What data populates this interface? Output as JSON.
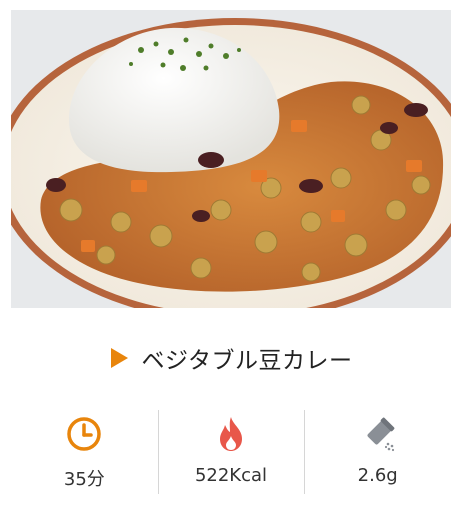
{
  "recipe": {
    "image_alt": "",
    "title": "ベジタブル豆カレー",
    "accent_color": "#e8850c",
    "stats": [
      {
        "icon": "clock-icon",
        "value": "35分"
      },
      {
        "icon": "flame-icon",
        "value": "522Kcal"
      },
      {
        "icon": "salt-shaker-icon",
        "value": "2.6g"
      }
    ]
  }
}
